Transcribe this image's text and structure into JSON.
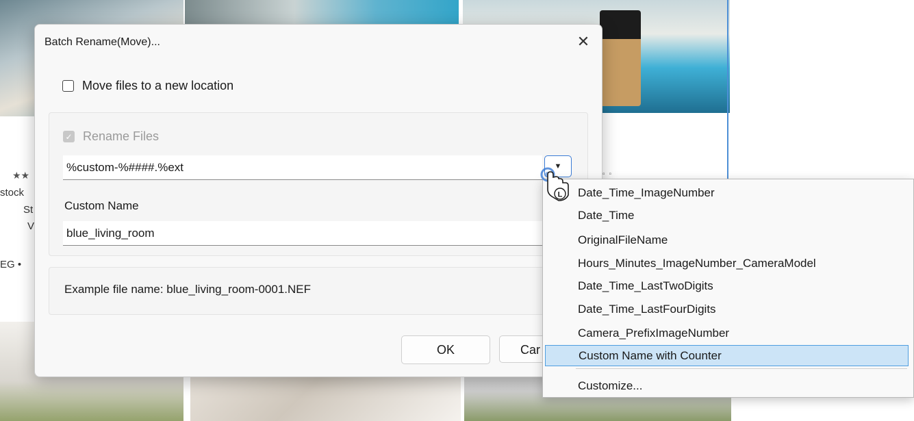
{
  "background": {
    "rating_stars": "★★",
    "meta_lines": [
      "stock",
      "St",
      "V",
      "EG •"
    ]
  },
  "dialog": {
    "title": "Batch Rename(Move)...",
    "close_glyph": "✕",
    "move_files": {
      "label": "Move files to a new location",
      "checked": false
    },
    "rename_files": {
      "label": "Rename Files",
      "checked": true,
      "enabled": false
    },
    "pattern_value": "%custom-%####.%ext",
    "dropdown_glyph": "▼",
    "custom_name_label": "Custom Name",
    "custom_name_value": "blue_living_room",
    "example_text": "Example file name: blue_living_room-0001.NEF",
    "ok_label": "OK",
    "cancel_label": "Car"
  },
  "menu": {
    "items": [
      "Date_Time_ImageNumber",
      "Date_Time",
      "OriginalFileName",
      "Hours_Minutes_ImageNumber_CameraModel",
      "Date_Time_LastTwoDigits",
      "Date_Time_LastFourDigits",
      "Camera_PrefixImageNumber",
      "Custom Name with Counter",
      "Customize..."
    ],
    "selected_index": 7
  },
  "cursor": {
    "button_label": "L",
    "accent": "#3a7bd5"
  }
}
